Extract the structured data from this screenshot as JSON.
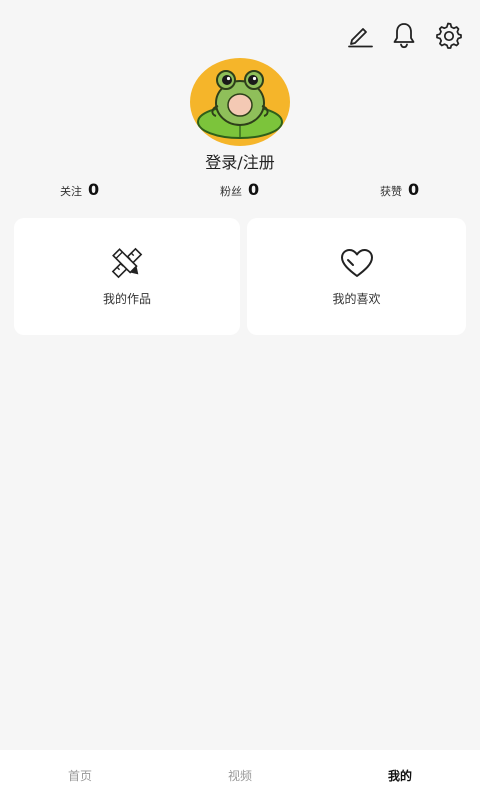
{
  "header": {
    "icons": [
      "edit-icon",
      "bell-icon",
      "settings-icon"
    ]
  },
  "profile": {
    "login_text": "登录/注册",
    "avatar_icon": "frog-avatar"
  },
  "stats": [
    {
      "label": "关注",
      "value": "0"
    },
    {
      "label": "粉丝",
      "value": "0"
    },
    {
      "label": "获赞",
      "value": "0"
    }
  ],
  "cards": {
    "works": {
      "label": "我的作品",
      "icon": "pencil-ruler-icon"
    },
    "likes": {
      "label": "我的喜欢",
      "icon": "heart-icon"
    }
  },
  "bottom_nav": {
    "items": [
      "首页",
      "视频",
      "我的"
    ],
    "active_index": 2
  },
  "colors": {
    "background": "#f6f6f6",
    "avatar_bg": "#f5b52a",
    "card_bg": "#ffffff",
    "active_text": "#111111",
    "inactive_text": "#999999"
  }
}
